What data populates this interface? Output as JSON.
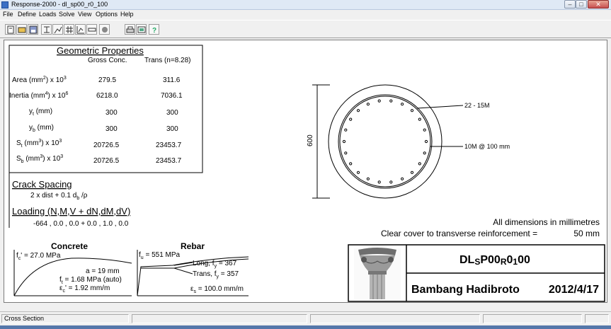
{
  "window": {
    "title": "Response-2000  -  dl_sp00_r0_100",
    "min_glyph": "–",
    "max_glyph": "□",
    "close_glyph": "✕"
  },
  "menu": [
    "File",
    "Define",
    "Loads",
    "Solve",
    "View",
    "Options",
    "Help"
  ],
  "geometric": {
    "title": "Geometric Properties",
    "col_gross": "Gross Conc.",
    "col_trans": "Trans (n=8.28)",
    "rows": [
      {
        "label": "Area (mm",
        "sup1": "2",
        "mid": ") x 10",
        "sup2": "3",
        "gross": "279.5",
        "trans": "311.6"
      },
      {
        "label": "Inertia (mm",
        "sup1": "4",
        "mid": ") x 10",
        "sup2": "6",
        "gross": "6218.0",
        "trans": "7036.1"
      },
      {
        "label": "y",
        "sub": "t",
        "rest": " (mm)",
        "gross": "300",
        "trans": "300"
      },
      {
        "label": "y",
        "sub": "b",
        "rest": " (mm)",
        "gross": "300",
        "trans": "300"
      },
      {
        "label": "S",
        "sub": "t",
        "mid": " (mm",
        "sup1": "3",
        "rest": ") x 10",
        "sup2": "3",
        "gross": "20726.5",
        "trans": "23453.7"
      },
      {
        "label": "S",
        "sub": "b",
        "mid": " (mm",
        "sup1": "3",
        "rest": ") x 10",
        "sup2": "3",
        "gross": "20726.5",
        "trans": "23453.7"
      }
    ]
  },
  "crack": {
    "title": "Crack Spacing",
    "formula_a": "2 x dist + 0.1 d",
    "formula_sub": "b",
    "formula_b": " /ρ"
  },
  "loading": {
    "title": "Loading (N,M,V + dN,dM,dV)",
    "values": "-664 , 0.0 , 0.0  +  0.0 , 1.0 , 0.0"
  },
  "concrete": {
    "title": "Concrete",
    "fc_label": "f",
    "fc_sub": "c",
    "fc_value": "' =  27.0 MPa",
    "a_text": "a =    19 mm",
    "ft_label": "f",
    "ft_sub": "t",
    "ft_value": " = 1.68 MPa (auto)",
    "ec_label": "ε",
    "ec_sub": "c",
    "ec_value": "' = 1.92 mm/m"
  },
  "rebar": {
    "title": "Rebar",
    "fu_label": "f",
    "fu_sub": "u",
    "fu_value": " =  551 MPa",
    "long_text": "Long, f",
    "long_sub": "y",
    "long_value": " = 367",
    "trans_text": "Trans, f",
    "trans_sub": "y",
    "trans_value": " = 357",
    "es_label": "ε",
    "es_sub": "s",
    "es_value": " = 100.0 mm/m"
  },
  "section": {
    "dimension": "600",
    "long_bars": "22 - 15M",
    "hoops": "10M @  100 mm",
    "bar_count": 22
  },
  "notes": {
    "dims": "All dimensions in millimetres",
    "cover_label": "Clear cover to transverse reinforcement =",
    "cover_value": "50 mm"
  },
  "titleblock": {
    "name_a": "DL",
    "name_b": "S",
    "name_c": "P00",
    "name_d": "R",
    "name_e": "0",
    "name_f": "1",
    "name_g": "00",
    "author": "Bambang Hadibroto",
    "date": "2012/4/17"
  },
  "status": {
    "view": "Cross Section"
  }
}
